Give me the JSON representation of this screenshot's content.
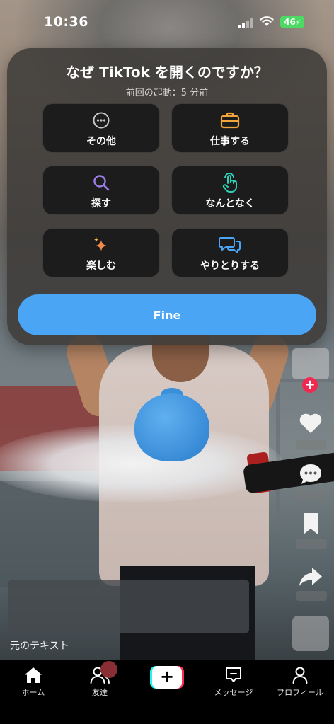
{
  "status_bar": {
    "time": "10:36",
    "battery": "46"
  },
  "modal": {
    "title": "なぜ TikTok を開くのですか？",
    "subtitle": "前回の起動：5 分前",
    "options": [
      {
        "label": "その他",
        "icon": "more-circle-icon",
        "icon_color": "#c9c9c9"
      },
      {
        "label": "仕事する",
        "icon": "briefcase-icon",
        "icon_color": "#f3a43a"
      },
      {
        "label": "探す",
        "icon": "search-icon",
        "icon_color": "#9b7fe6"
      },
      {
        "label": "なんとなく",
        "icon": "tap-hand-icon",
        "icon_color": "#2fd1b7"
      },
      {
        "label": "楽しむ",
        "icon": "sparkles-icon",
        "icon_color": "#f08a4b"
      },
      {
        "label": "やりとりする",
        "icon": "chat-bubbles-icon",
        "icon_color": "#4aa5f5"
      }
    ],
    "confirm_label": "Fine",
    "confirm_color": "#4aa5f5"
  },
  "video": {
    "original_text_label": "元のテキスト"
  },
  "rail": {
    "icons": [
      "heart-icon",
      "comment-icon",
      "bookmark-icon",
      "share-icon"
    ]
  },
  "tab_bar": {
    "home": "ホーム",
    "friends": "友達",
    "create_symbol": "+",
    "inbox": "メッセージ",
    "profile": "プロフィール"
  }
}
